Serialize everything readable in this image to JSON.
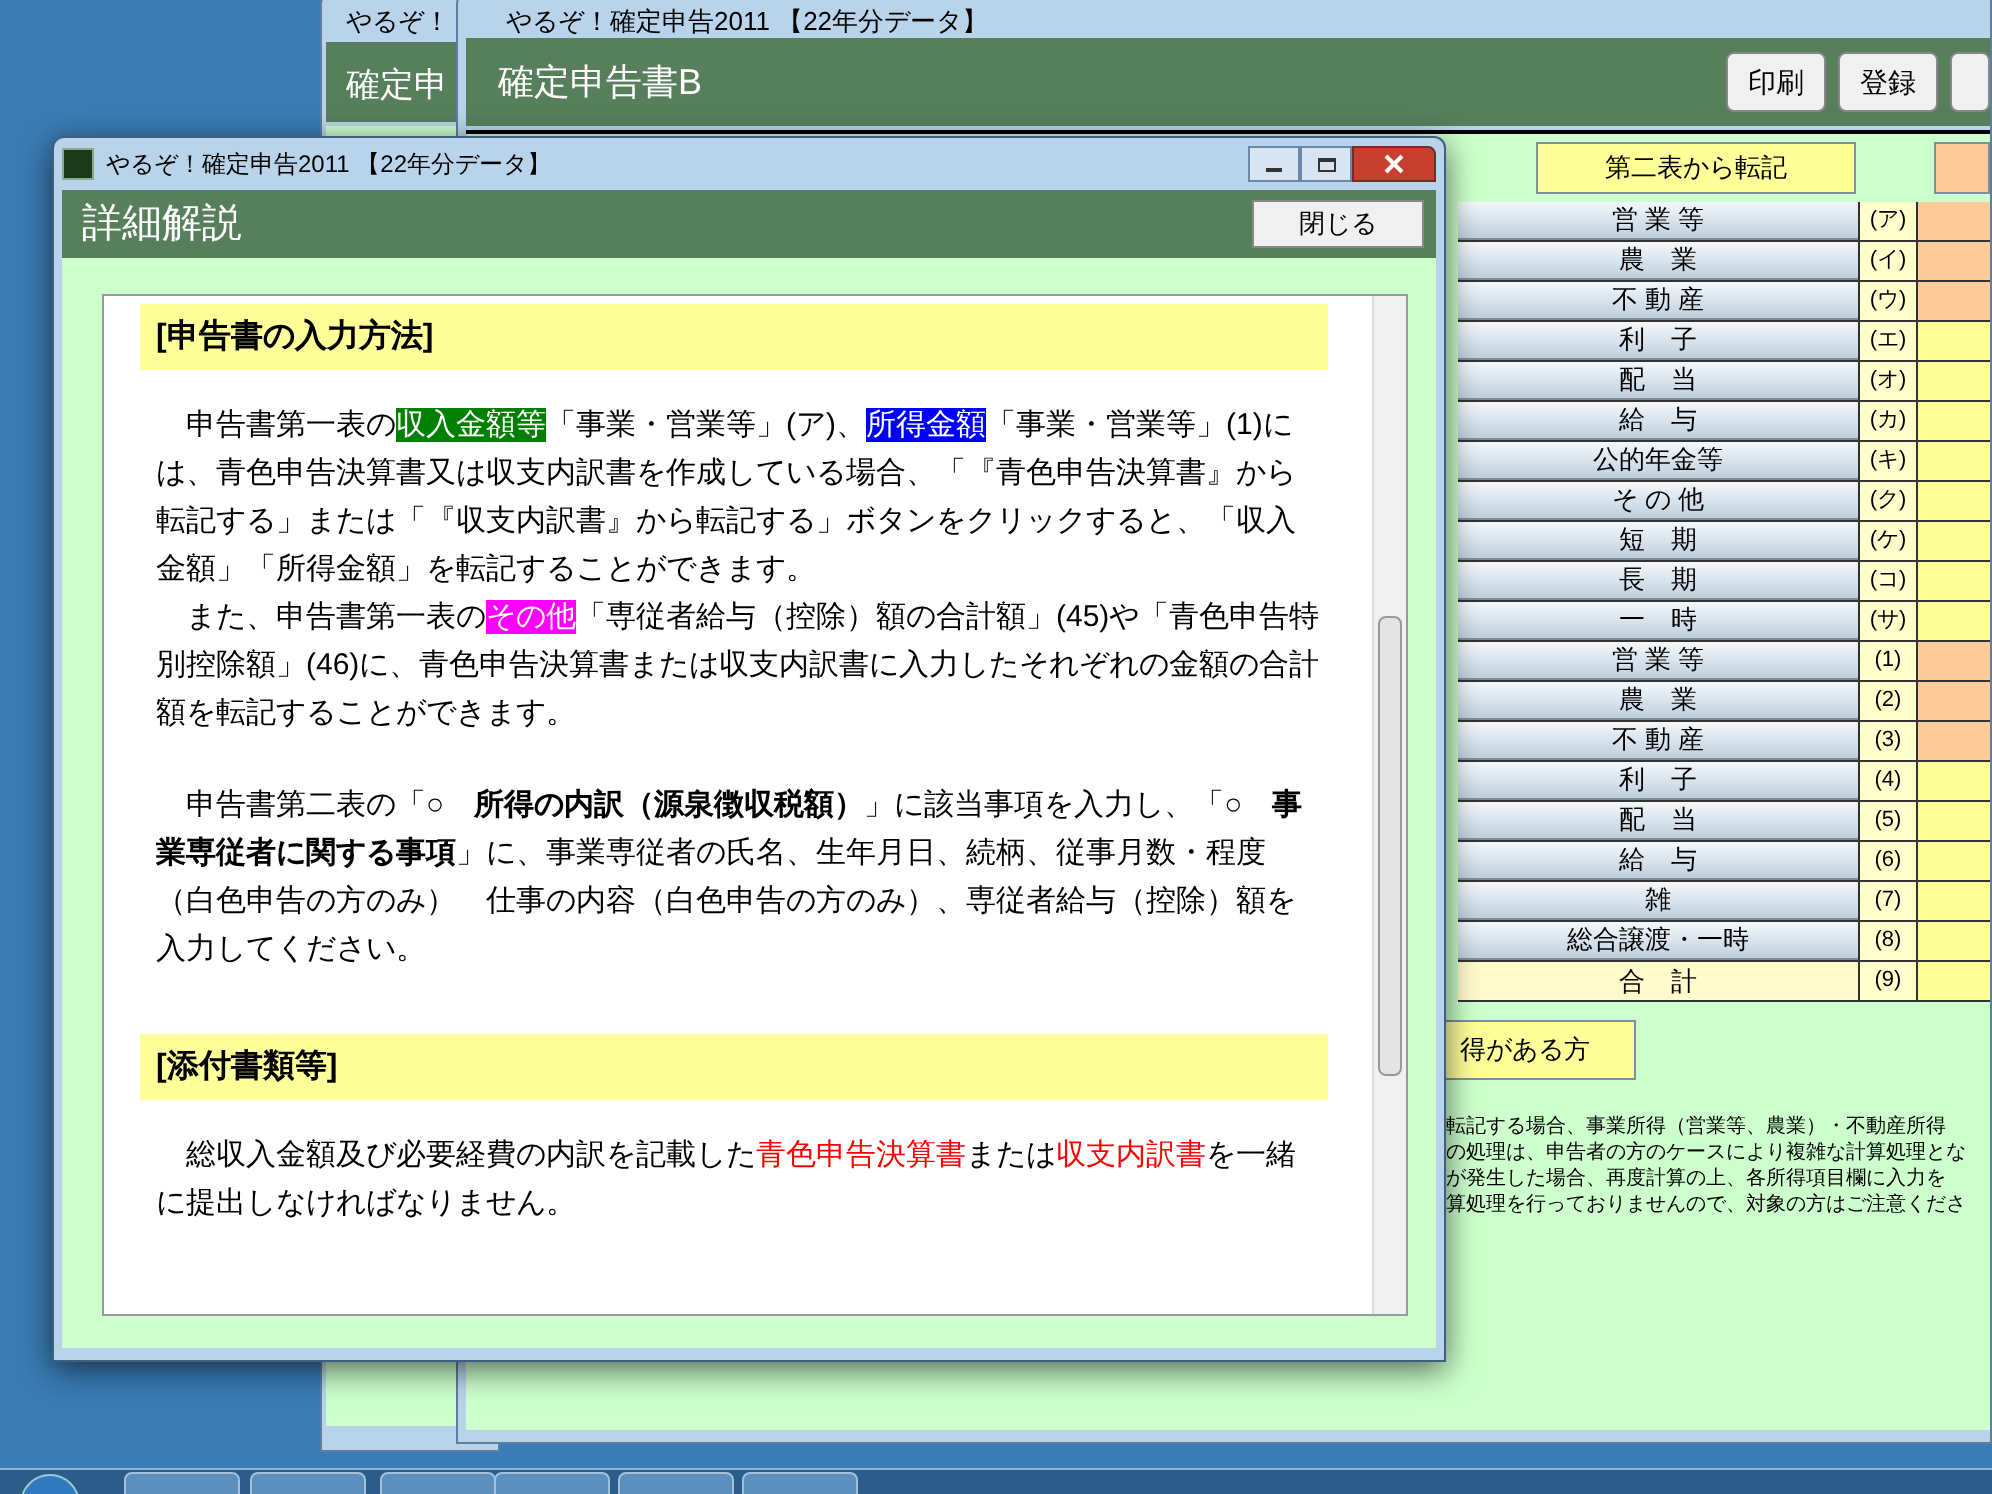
{
  "back_window": {
    "title": "やるぞ！",
    "header": "確定申"
  },
  "main_window": {
    "title": "やるぞ！確定申告2011 【22年分データ】",
    "header": "確定申告書B",
    "buttons": [
      "印刷",
      "登録"
    ],
    "transfer_label": "第二表から転記",
    "rows": [
      {
        "label": "営 業 等",
        "code": "(ア)",
        "kind": "item",
        "color": "#ffcc99"
      },
      {
        "label": "農　業",
        "code": "(イ)",
        "kind": "item",
        "color": "#ffcc99"
      },
      {
        "label": "不 動 産",
        "code": "(ウ)",
        "kind": "item",
        "color": "#ffcc99"
      },
      {
        "label": "利　子",
        "code": "(エ)",
        "kind": "item",
        "color": "#ffff99"
      },
      {
        "label": "配　当",
        "code": "(オ)",
        "kind": "item",
        "color": "#ffff99"
      },
      {
        "label": "給　与",
        "code": "(カ)",
        "kind": "item",
        "color": "#ffff99"
      },
      {
        "label": "公的年金等",
        "code": "(キ)",
        "kind": "item",
        "color": "#ffff99"
      },
      {
        "label": "そ の 他",
        "code": "(ク)",
        "kind": "item",
        "color": "#ffff99"
      },
      {
        "label": "短　期",
        "code": "(ケ)",
        "kind": "item",
        "color": "#ffff99"
      },
      {
        "label": "長　期",
        "code": "(コ)",
        "kind": "item",
        "color": "#ffff99"
      },
      {
        "label": "一　時",
        "code": "(サ)",
        "kind": "item",
        "color": "#ffff99"
      },
      {
        "label": "営 業 等",
        "code": "(1)",
        "kind": "item",
        "color": "#ffcc99"
      },
      {
        "label": "農　業",
        "code": "(2)",
        "kind": "item",
        "color": "#ffcc99"
      },
      {
        "label": "不 動 産",
        "code": "(3)",
        "kind": "item",
        "color": "#ffcc99"
      },
      {
        "label": "利　子",
        "code": "(4)",
        "kind": "item",
        "color": "#ffff99"
      },
      {
        "label": "配　当",
        "code": "(5)",
        "kind": "item",
        "color": "#ffff99"
      },
      {
        "label": "給　与",
        "code": "(6)",
        "kind": "item",
        "color": "#ffff99"
      },
      {
        "label": "雑",
        "code": "(7)",
        "kind": "item",
        "color": "#ffff99"
      },
      {
        "label": "総合譲渡・一時",
        "code": "(8)",
        "kind": "item",
        "color": "#ffff99"
      },
      {
        "label": "合　計",
        "code": "(9)",
        "kind": "total",
        "color": "#ffff99"
      }
    ],
    "income_label": "得がある方",
    "notes": [
      "転記する場合、事業所得（営業等、農業）・不動産所得",
      "の処理は、申告者の方のケースにより複雑な計算処理とな",
      "が発生した場合、再度計算の上、各所得項目欄に入力を",
      "算処理を行っておりませんので、対象の方はご注意くださ"
    ]
  },
  "dialog": {
    "title": "やるぞ！確定申告2011 【22年分データ】",
    "header": "詳細解説",
    "close_button": "閉じる",
    "sections": [
      {
        "heading": "[申告書の入力方法]",
        "paragraphs": [
          [
            {
              "kind": "plain",
              "text": "申告書第一表の"
            },
            {
              "kind": "highlight",
              "color": "#008000",
              "text": "収入金額等"
            },
            {
              "kind": "plain",
              "text": "「事業・営業等」(ア)、"
            },
            {
              "kind": "highlight",
              "color": "#0000ff",
              "text": "所得金額"
            },
            {
              "kind": "plain",
              "text": "「事業・営業等」(1)には、青色申告決算書又は収支内訳書を作成している場合、「『青色申告決算書』から転記する」または「『収支内訳書』から転記する」ボタンをクリックすると、「収入金額」「所得金額」を転記することができます。"
            }
          ],
          [
            {
              "kind": "plain",
              "text": "また、申告書第一表の"
            },
            {
              "kind": "highlight",
              "color": "#ff00ff",
              "text": "その他"
            },
            {
              "kind": "plain",
              "text": "「専従者給与（控除）額の合計額」(45)や「青色申告特別控除額」(46)に、青色申告決算書または収支内訳書に入力したそれぞれの金額の合計額を転記することができます。"
            }
          ],
          [
            {
              "kind": "gap"
            }
          ],
          [
            {
              "kind": "plain",
              "text": "申告書第二表の「"
            },
            {
              "kind": "bold",
              "text": "○　所得の内訳（源泉徴収税額）"
            },
            {
              "kind": "plain",
              "text": "」に該当事項を入力し、「"
            },
            {
              "kind": "bold",
              "text": "○　事業専従者に関する事項"
            },
            {
              "kind": "plain",
              "text": "」に、事業専従者の氏名、生年月日、続柄、従事月数・程度（白色申告の方のみ）　仕事の内容（白色申告の方のみ）、専従者給与（控除）額を入力してください。"
            }
          ]
        ]
      },
      {
        "heading": "[添付書類等]",
        "paragraphs": [
          [
            {
              "kind": "plain",
              "text": "総収入金額及び必要経費の内訳を記載した"
            },
            {
              "kind": "red",
              "text": "青色申告決算書"
            },
            {
              "kind": "plain",
              "text": "または"
            },
            {
              "kind": "red",
              "text": "収支内訳書"
            },
            {
              "kind": "plain",
              "text": "を一緒に提出しなければなりません。"
            }
          ]
        ]
      }
    ]
  }
}
